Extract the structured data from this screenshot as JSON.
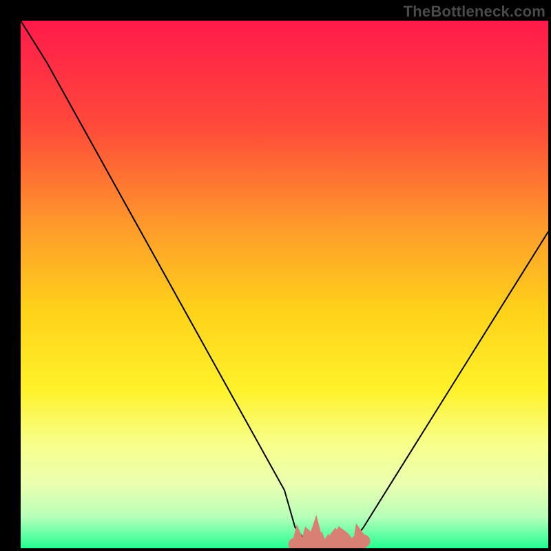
{
  "watermark": "TheBottleneck.com",
  "chart_data": {
    "type": "line",
    "title": "",
    "xlabel": "",
    "ylabel": "",
    "xlim": [
      0,
      100
    ],
    "ylim": [
      0,
      100
    ],
    "grid": false,
    "legend": false,
    "background": {
      "type": "vertical-gradient",
      "stops": [
        {
          "pos": 0,
          "color": "#ff1a4b"
        },
        {
          "pos": 0.2,
          "color": "#ff4a3a"
        },
        {
          "pos": 0.4,
          "color": "#ff9e2a"
        },
        {
          "pos": 0.55,
          "color": "#ffd21a"
        },
        {
          "pos": 0.7,
          "color": "#fff22a"
        },
        {
          "pos": 0.8,
          "color": "#f8ff8a"
        },
        {
          "pos": 0.88,
          "color": "#eaffb0"
        },
        {
          "pos": 0.94,
          "color": "#b8ffb8"
        },
        {
          "pos": 1.0,
          "color": "#23ff93"
        }
      ]
    },
    "series": [
      {
        "name": "bottleneck-curve",
        "stroke": "#000000",
        "stroke_width": 2,
        "x": [
          0,
          5,
          10,
          15,
          20,
          25,
          30,
          35,
          40,
          45,
          50,
          52,
          55,
          58,
          62,
          65,
          70,
          75,
          80,
          85,
          90,
          95,
          100
        ],
        "y": [
          100,
          92,
          83,
          74,
          65,
          56,
          47,
          38,
          29,
          20,
          11,
          4,
          0,
          0,
          0,
          4,
          12,
          20,
          28,
          36,
          44,
          52,
          60
        ]
      }
    ],
    "highlight_bar": {
      "name": "flat-minimum",
      "color": "#d98074",
      "x_start": 52,
      "x_end": 65,
      "y": 0,
      "thickness": 2.5
    }
  }
}
